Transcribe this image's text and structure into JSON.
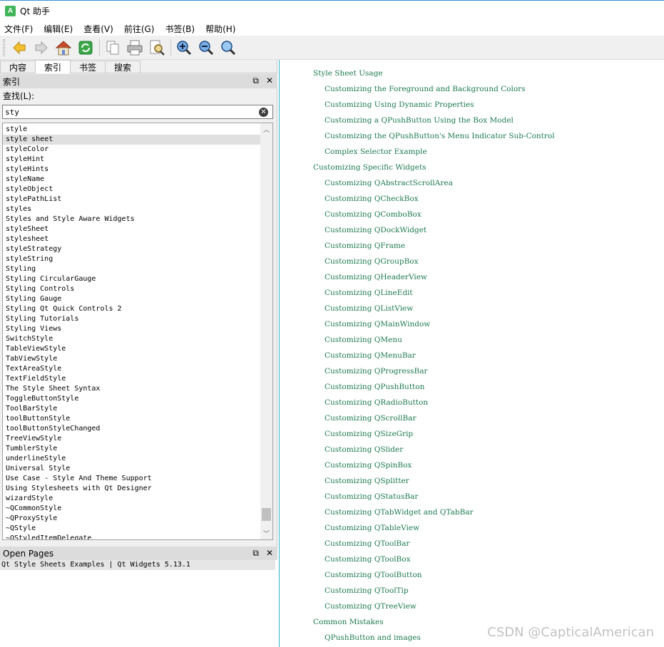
{
  "window": {
    "title": "Qt 助手",
    "icon_letter": "A"
  },
  "menu": [
    "文件(F)",
    "编辑(E)",
    "查看(V)",
    "前往(G)",
    "书签(B)",
    "帮助(H)"
  ],
  "toolbar": {
    "icons": [
      "back-icon",
      "forward-icon",
      "home-icon",
      "sync-icon",
      "copy-icon",
      "print-icon",
      "find-in-page-icon",
      "zoom-in-icon",
      "zoom-out-icon",
      "zoom-reset-icon"
    ]
  },
  "left_tabs": [
    "内容",
    "索引",
    "书签",
    "搜索"
  ],
  "active_tab": "索引",
  "index_panel": {
    "title": "索引",
    "find_label": "查找(L):",
    "search_value": "sty",
    "items": [
      "style",
      "style sheet",
      "styleColor",
      "styleHint",
      "styleHints",
      "styleName",
      "styleObject",
      "stylePathList",
      "styles",
      "Styles and Style Aware Widgets",
      "styleSheet",
      "stylesheet",
      "styleStrategy",
      "styleString",
      "Styling",
      "Styling CircularGauge",
      "Styling Controls",
      "Styling Gauge",
      "Styling Qt Quick Controls 2",
      "Styling Tutorials",
      "Styling Views",
      "SwitchStyle",
      "TableViewStyle",
      "TabViewStyle",
      "TextAreaStyle",
      "TextFieldStyle",
      "The Style Sheet Syntax",
      "ToggleButtonStyle",
      "ToolBarStyle",
      "toolButtonStyle",
      "toolButtonStyleChanged",
      "TreeViewStyle",
      "TumblerStyle",
      "underlineStyle",
      "Universal Style",
      "Use Case - Style And Theme Support",
      "Using Stylesheets with Qt Designer",
      "wizardStyle",
      "~QCommonStyle",
      "~QProxyStyle",
      "~QStyle",
      "~QStyledItemDelegate"
    ],
    "selected": "style sheet"
  },
  "open_pages": {
    "title": "Open Pages",
    "items": [
      "Qt Style Sheets Examples | Qt Widgets 5.13.1"
    ]
  },
  "doc_links": [
    {
      "level": 1,
      "text": "Style Sheet Usage"
    },
    {
      "level": 2,
      "text": "Customizing the Foreground and Background Colors"
    },
    {
      "level": 2,
      "text": "Customizing Using Dynamic Properties"
    },
    {
      "level": 2,
      "text": "Customizing a QPushButton Using the Box Model"
    },
    {
      "level": 2,
      "text": "Customizing the QPushButton's Menu Indicator Sub-Control"
    },
    {
      "level": 2,
      "text": "Complex Selector Example"
    },
    {
      "level": 1,
      "text": "Customizing Specific Widgets"
    },
    {
      "level": 2,
      "text": "Customizing QAbstractScrollArea"
    },
    {
      "level": 2,
      "text": "Customizing QCheckBox"
    },
    {
      "level": 2,
      "text": "Customizing QComboBox"
    },
    {
      "level": 2,
      "text": "Customizing QDockWidget"
    },
    {
      "level": 2,
      "text": "Customizing QFrame"
    },
    {
      "level": 2,
      "text": "Customizing QGroupBox"
    },
    {
      "level": 2,
      "text": "Customizing QHeaderView"
    },
    {
      "level": 2,
      "text": "Customizing QLineEdit"
    },
    {
      "level": 2,
      "text": "Customizing QListView"
    },
    {
      "level": 2,
      "text": "Customizing QMainWindow"
    },
    {
      "level": 2,
      "text": "Customizing QMenu"
    },
    {
      "level": 2,
      "text": "Customizing QMenuBar"
    },
    {
      "level": 2,
      "text": "Customizing QProgressBar"
    },
    {
      "level": 2,
      "text": "Customizing QPushButton"
    },
    {
      "level": 2,
      "text": "Customizing QRadioButton"
    },
    {
      "level": 2,
      "text": "Customizing QScrollBar"
    },
    {
      "level": 2,
      "text": "Customizing QSizeGrip"
    },
    {
      "level": 2,
      "text": "Customizing QSlider"
    },
    {
      "level": 2,
      "text": "Customizing QSpinBox"
    },
    {
      "level": 2,
      "text": "Customizing QSplitter"
    },
    {
      "level": 2,
      "text": "Customizing QStatusBar"
    },
    {
      "level": 2,
      "text": "Customizing QTabWidget and QTabBar"
    },
    {
      "level": 2,
      "text": "Customizing QTableView"
    },
    {
      "level": 2,
      "text": "Customizing QToolBar"
    },
    {
      "level": 2,
      "text": "Customizing QToolBox"
    },
    {
      "level": 2,
      "text": "Customizing QToolButton"
    },
    {
      "level": 2,
      "text": "Customizing QToolTip"
    },
    {
      "level": 2,
      "text": "Customizing QTreeView"
    },
    {
      "level": 1,
      "text": "Common Mistakes"
    },
    {
      "level": 2,
      "text": "QPushButton and images"
    }
  ],
  "watermark": "CSDN @CapticalAmerican",
  "colors": {
    "link": "#1e7a52",
    "accent": "#3bb0c8",
    "app_icon": "#41b55a"
  }
}
